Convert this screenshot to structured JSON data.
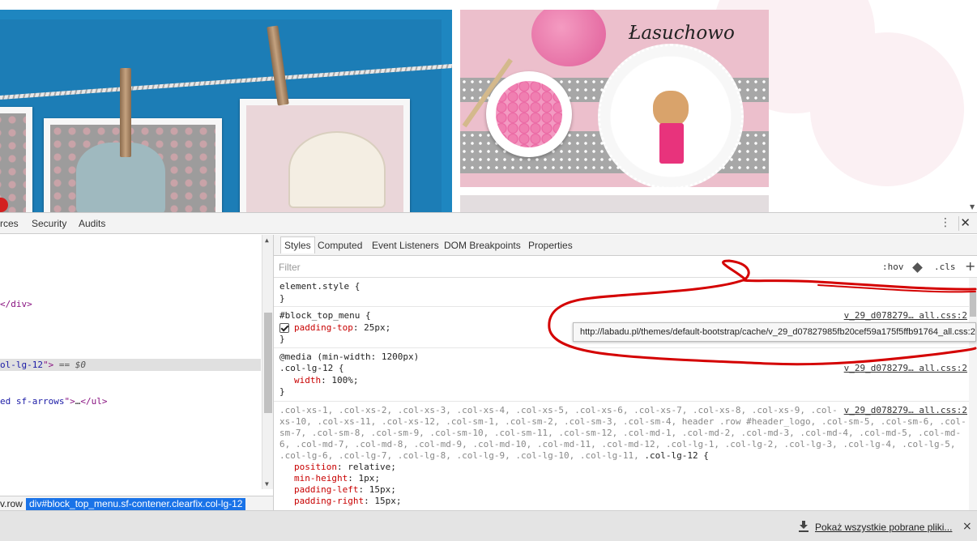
{
  "page": {
    "brand_text": "Łasuchowo"
  },
  "devtools": {
    "top_tabs": [
      "rces",
      "Security",
      "Audits"
    ],
    "menu_icon": "kebab-menu-icon",
    "close_icon": "close-icon",
    "elements_panel": {
      "line1_tail": "</div>",
      "selected_line": {
        "attr_tail": "ol-lg-12",
        "after_attr": "\">",
        "eq": " == ",
        "dollar": "$0"
      },
      "line3": {
        "attr_tail": "ed sf-arrows",
        "after_attr": "\">",
        "ellipsis": "…",
        "close_tag": "</ul>"
      }
    },
    "breadcrumb": {
      "items": [
        "v.row",
        "div#block_top_menu.sf-contener.clearfix.col-lg-12"
      ]
    },
    "styles_panel": {
      "tabs": [
        "Styles",
        "Computed",
        "Event Listeners",
        "DOM Breakpoints",
        "Properties"
      ],
      "filter_placeholder": "Filter",
      "hov": ":hov",
      "cls": ".cls",
      "plus": "+",
      "rules": {
        "element_style": {
          "selector": "element.style {",
          "close": "}"
        },
        "block_top_menu": {
          "selector": "#block_top_menu {",
          "source": "v_29_d078279… all.css:2",
          "prop": "padding-top",
          "value": "25px;",
          "close": "}"
        },
        "media_rule": {
          "media": "@media (min-width: 1200px)",
          "selector": ".col-lg-12 {",
          "source": "v_29_d078279… all.css:2",
          "prop": "width",
          "value": "100%;",
          "close": "}"
        },
        "col_rule": {
          "source": "v_29_d078279… all.css:2",
          "selector_lines": [
            ".col-xs-1, .col-xs-2, .col-xs-3, .col-xs-4, .col-xs-5, .col-xs-6, .col-xs-7, .col-xs-8, .col-xs-9, .col-",
            "xs-10, .col-xs-11, .col-xs-12, .col-sm-1, .col-sm-2, .col-sm-3, .col-sm-4, header .row #header_logo, .col-sm-5, .col-sm-6, .col-",
            "sm-7, .col-sm-8, .col-sm-9, .col-sm-10, .col-sm-11, .col-sm-12, .col-md-1, .col-md-2, .col-md-3, .col-md-4, .col-md-5, .col-md-",
            "6, .col-md-7, .col-md-8, .col-md-9, .col-md-10, .col-md-11, .col-md-12, .col-lg-1, .col-lg-2, .col-lg-3, .col-lg-4, .col-lg-5,",
            ".col-lg-6, .col-lg-7, .col-lg-8, .col-lg-9, .col-lg-10, .col-lg-11, "
          ],
          "selector_match": ".col-lg-12 {",
          "props": [
            {
              "prop": "position",
              "value": "relative;"
            },
            {
              "prop": "min-height",
              "value": "1px;"
            },
            {
              "prop": "padding-left",
              "value": "15px;"
            },
            {
              "prop": "padding-right",
              "value": "15px;"
            }
          ]
        }
      },
      "tooltip_url": "http://labadu.pl/themes/default-bootstrap/cache/v_29_d07827985fb20cef59a175f5ffb91764_all.css:2"
    }
  },
  "downloads_bar": {
    "link_text": "Pokaż wszystkie pobrane pliki...",
    "close": "×"
  },
  "colors": {
    "accent": "#1a73e8",
    "annotation": "#d40000",
    "css_property": "#c80000",
    "html_tag": "#881280"
  }
}
